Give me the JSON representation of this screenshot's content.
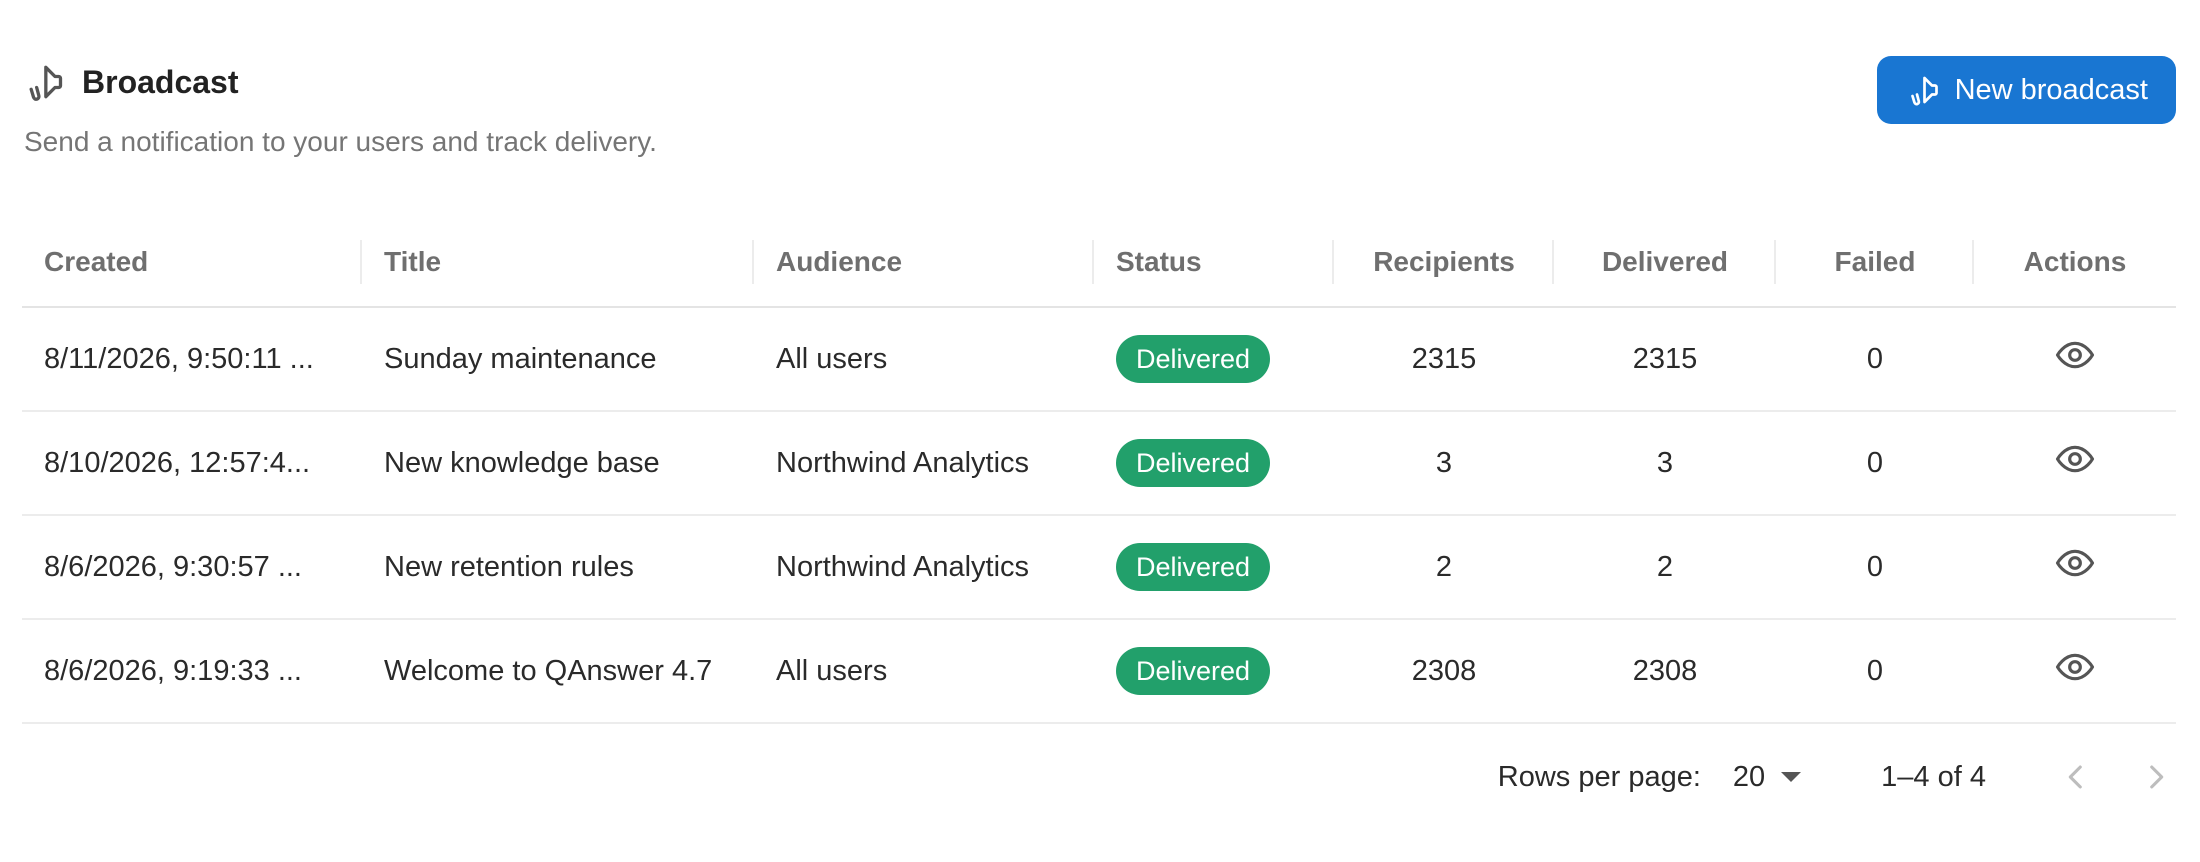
{
  "header": {
    "title": "Broadcast",
    "subtitle": "Send a notification to your users and track delivery.",
    "title_icon": "megaphone-icon",
    "new_button_label": "New broadcast",
    "new_button_icon": "megaphone-icon"
  },
  "table": {
    "columns": {
      "created": "Created",
      "title": "Title",
      "audience": "Audience",
      "status": "Status",
      "recipients": "Recipients",
      "delivered": "Delivered",
      "failed": "Failed",
      "actions": "Actions"
    },
    "rows": [
      {
        "created": "8/11/2026, 9:50:11 ...",
        "title": "Sunday maintenance",
        "audience": "All users",
        "status": "Delivered",
        "recipients": "2315",
        "delivered": "2315",
        "failed": "0",
        "action_icon": "eye-icon"
      },
      {
        "created": "8/10/2026, 12:57:4...",
        "title": "New knowledge base",
        "audience": "Northwind Analytics",
        "status": "Delivered",
        "recipients": "3",
        "delivered": "3",
        "failed": "0",
        "action_icon": "eye-icon"
      },
      {
        "created": "8/6/2026, 9:30:57 ...",
        "title": "New retention rules",
        "audience": "Northwind Analytics",
        "status": "Delivered",
        "recipients": "2",
        "delivered": "2",
        "failed": "0",
        "action_icon": "eye-icon"
      },
      {
        "created": "8/6/2026, 9:19:33 ...",
        "title": "Welcome to QAnswer 4.7",
        "audience": "All users",
        "status": "Delivered",
        "recipients": "2308",
        "delivered": "2308",
        "failed": "0",
        "action_icon": "eye-icon"
      }
    ]
  },
  "pagination": {
    "rows_per_page_label": "Rows per page:",
    "rows_per_page_value": "20",
    "range_text": "1–4 of 4"
  },
  "colors": {
    "accent": "#1976d2",
    "status_delivered": "#22a06b"
  }
}
